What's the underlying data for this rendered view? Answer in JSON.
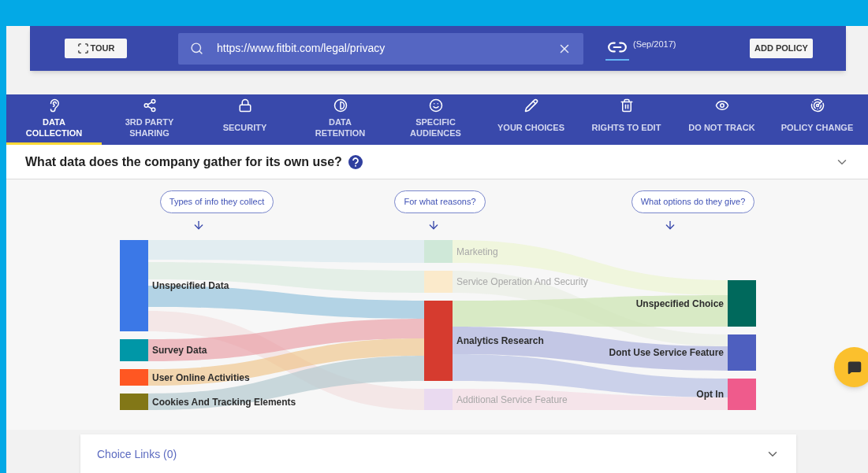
{
  "header": {
    "tour_button": "TOUR",
    "search": {
      "value": "https://www.fitbit.com/legal/privacy"
    },
    "policy_date": "(Sep/2017)",
    "add_policy_button": "ADD POLICY"
  },
  "tabs": [
    {
      "label": "DATA COLLECTION",
      "selected": true
    },
    {
      "label": "3RD PARTY SHARING",
      "selected": false
    },
    {
      "label": "SECURITY",
      "selected": false
    },
    {
      "label": "DATA RETENTION",
      "selected": false
    },
    {
      "label": "SPECIFIC AUDIENCES",
      "selected": false
    },
    {
      "label": "YOUR CHOICES",
      "selected": false
    },
    {
      "label": "RIGHTS TO EDIT",
      "selected": false
    },
    {
      "label": "DO NOT TRACK",
      "selected": false
    },
    {
      "label": "POLICY CHANGE",
      "selected": false
    }
  ],
  "question": {
    "text": "What data does the company gather for its own use?",
    "expanded": true
  },
  "sankey": {
    "columns": [
      {
        "heading": "Types of info they collect",
        "nodes": [
          {
            "label": "Unspecified Data",
            "color": "#3b78e7",
            "dimmed": false
          },
          {
            "label": "Survey Data",
            "color": "#0097a7",
            "dimmed": false
          },
          {
            "label": "User Online Activities",
            "color": "#ff5722",
            "dimmed": false
          },
          {
            "label": "Cookies And Tracking Elements",
            "color": "#827717",
            "dimmed": false
          }
        ]
      },
      {
        "heading": "For what reasons?",
        "nodes": [
          {
            "label": "Marketing",
            "color": "#cfe8d8",
            "dimmed": true
          },
          {
            "label": "Service Operation And Security",
            "color": "#fbeacb",
            "dimmed": true
          },
          {
            "label": "Analytics Research",
            "color": "#d63b2f",
            "dimmed": false
          },
          {
            "label": "Additional Service Feature",
            "color": "#eadaf0",
            "dimmed": true
          }
        ]
      },
      {
        "heading": "What options do they give?",
        "nodes": [
          {
            "label": "Unspecified Choice",
            "color": "#00695c",
            "dimmed": false
          },
          {
            "label": "Dont Use Service Feature",
            "color": "#4e5fbf",
            "dimmed": false
          },
          {
            "label": "Opt In",
            "color": "#ef5b8c",
            "dimmed": false
          }
        ]
      }
    ]
  },
  "choice_links": {
    "label": "Choice Links (0)",
    "expanded": false
  }
}
